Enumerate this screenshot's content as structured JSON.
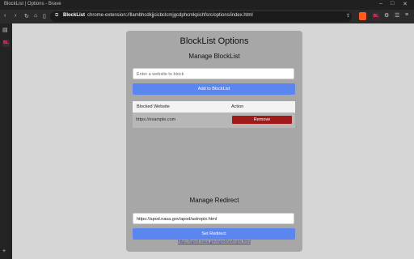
{
  "window": {
    "title": "BlockList | Options - Brave",
    "controls": [
      "–",
      "□",
      "✕"
    ]
  },
  "toolbar": {
    "site_name": "BlockList",
    "url": "chrome-extension://llambhcdkjjcicbclcmjgcdphcmkpichfsrc/options/index.html",
    "icons": [
      "back-icon",
      "forward-icon",
      "reload-icon",
      "home-icon",
      "bookmark-icon",
      "brave-shield-icon",
      "extension-badge-icon",
      "puzzle-icon",
      "reading-list-icon",
      "menu-icon"
    ],
    "extension_badge": "BL"
  },
  "sidebar": {
    "icons": [
      "sidebar-toggle-icon",
      "extension-icon",
      "add-icon"
    ]
  },
  "panel": {
    "title": "BlockList Options",
    "manage_blocklist": "Manage BlockList",
    "website_input_placeholder": "Enter a website to block",
    "add_button": "Add to BlockList",
    "table": {
      "headers": [
        "Blocked Website",
        "Action"
      ],
      "rows": [
        {
          "site": "https://example.com",
          "action": "Remove"
        }
      ]
    },
    "manage_redirect": "Manage Redirect",
    "redirect_input_value": "https://apod.nasa.gov/apod/astropix.html",
    "set_redirect_button": "Set Redirect",
    "current_redirect_link": "https://apod.nasa.gov/apod/astropix.html"
  },
  "colors": {
    "page_bg": "#d6d6d6",
    "panel_bg": "#a7a7a7",
    "primary_button": "#5b86f0",
    "remove_button": "#a01a1a",
    "chrome_dark": "#2b2b2b"
  }
}
